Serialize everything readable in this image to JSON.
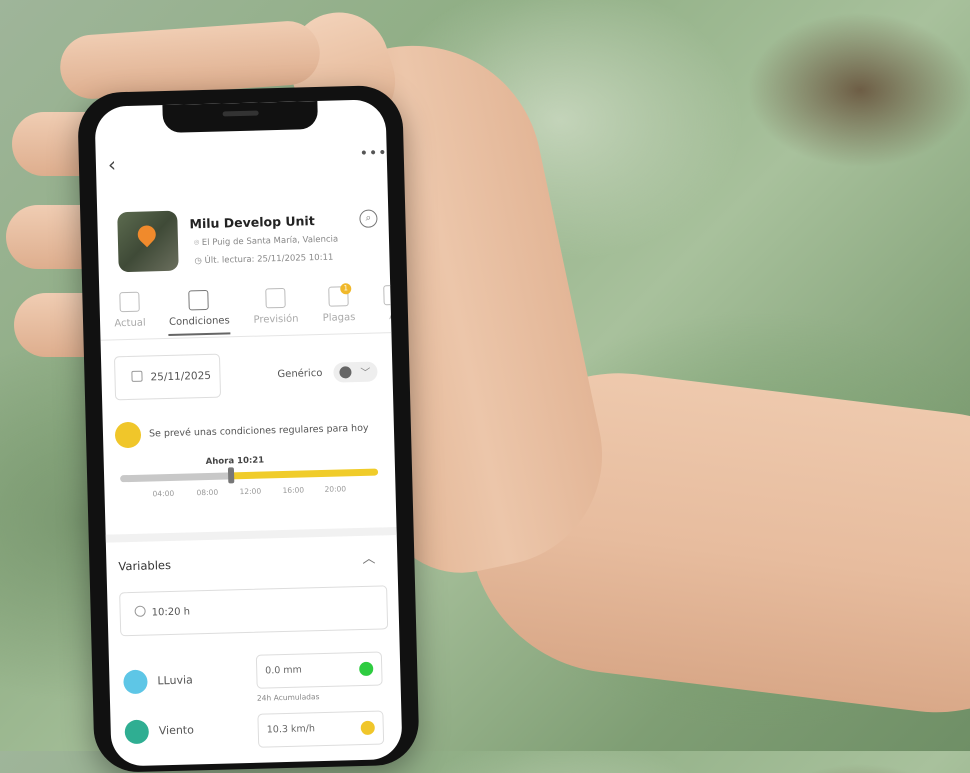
{
  "app": {
    "device_name": "Milu Develop Unit",
    "location": "El Puig de Santa María, Valencia",
    "last_reading": "Últ. lectura: 25/11/2025 10:11"
  },
  "tabs": [
    {
      "label": "Actual"
    },
    {
      "label": "Condiciones",
      "active": true
    },
    {
      "label": "Previsión"
    },
    {
      "label": "Plagas",
      "badge": "1"
    },
    {
      "label": "Al"
    }
  ],
  "filter": {
    "date": "25/11/2025",
    "profile_label": "Genérico"
  },
  "conditions": {
    "message": "Se prevé unas condiciones regulares para hoy",
    "now_label": "Ahora 10:21",
    "ticks": [
      "04:00",
      "08:00",
      "12:00",
      "16:00",
      "20:00"
    ],
    "progress_fraction": 0.43
  },
  "variables": {
    "title": "Variables",
    "time": "10:20 h",
    "items": [
      {
        "label": "LLuvia",
        "value": "0.0 mm",
        "note": "24h Acumuladas",
        "status_color": "#2ecc40",
        "icon": "rain-cloud-icon"
      },
      {
        "label": "Viento",
        "value": "10.3 km/h",
        "status_color": "#f0c62a",
        "icon": "wind-icon"
      }
    ]
  },
  "icons": {
    "back": "‹",
    "more": "•••",
    "search": "⌕",
    "chevron_up": "︿",
    "chevron_down": "﹀"
  },
  "colors": {
    "accent_yellow": "#f0cc2a",
    "pin_orange": "#f08a2c"
  }
}
